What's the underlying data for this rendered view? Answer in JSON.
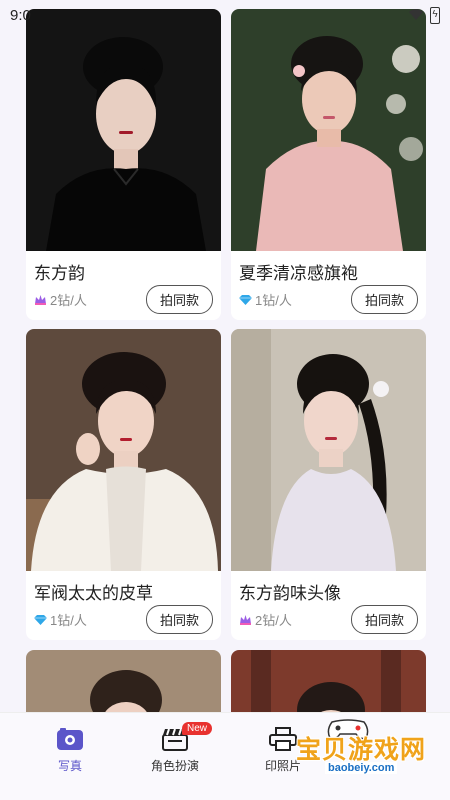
{
  "status": {
    "time": "9:0",
    "battery_glyph": "ϟ"
  },
  "cards": [
    {
      "title": "东方韵",
      "price": "2钻/人",
      "price_icon": "crown-gem-icon",
      "button": "拍同款",
      "bg": "#1a1a1a",
      "accent": "#0e0e0e"
    },
    {
      "title": "夏季清凉感旗袍",
      "price": "1钻/人",
      "price_icon": "diamond-icon",
      "button": "拍同款",
      "bg": "#2f4a2c",
      "accent": "#e9b7b8"
    },
    {
      "title": "军阀太太的皮草",
      "price": "1钻/人",
      "price_icon": "diamond-icon",
      "button": "拍同款",
      "bg": "#6b5647",
      "accent": "#f1ece6"
    },
    {
      "title": "东方韵味头像",
      "price": "2钻/人",
      "price_icon": "crown-gem-icon",
      "button": "拍同款",
      "bg": "#c8c3b9",
      "accent": "#e9e5ee"
    },
    {
      "title": "",
      "price": "",
      "price_icon": "",
      "button": "",
      "bg": "#a4907a",
      "accent": "#3a2a22"
    },
    {
      "title": "",
      "price": "",
      "price_icon": "",
      "button": "",
      "bg": "#8a3c2e",
      "accent": "#2a2a2a"
    }
  ],
  "nav": {
    "items": [
      {
        "label": "写真",
        "icon": "camera-icon",
        "active": true
      },
      {
        "label": "角色扮演",
        "icon": "clapperboard-icon",
        "badge": "New"
      },
      {
        "label": "印照片",
        "icon": "printer-icon"
      }
    ]
  },
  "watermark": {
    "text": "宝贝游戏网",
    "url": "baobeiy.com"
  },
  "colors": {
    "accent": "#5b55c9",
    "badge": "#e8322f",
    "diamond": "#2fa7e8"
  }
}
